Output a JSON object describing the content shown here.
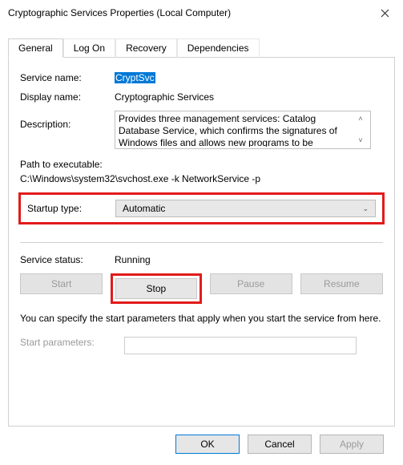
{
  "window": {
    "title": "Cryptographic Services Properties (Local Computer)"
  },
  "tabs": {
    "items": [
      {
        "label": "General"
      },
      {
        "label": "Log On"
      },
      {
        "label": "Recovery"
      },
      {
        "label": "Dependencies"
      }
    ]
  },
  "general": {
    "service_name_label": "Service name:",
    "service_name_value": "CryptSvc",
    "display_name_label": "Display name:",
    "display_name_value": "Cryptographic Services",
    "description_label": "Description:",
    "description_value": "Provides three management services: Catalog Database Service, which confirms the signatures of Windows files and allows new programs to be",
    "path_label": "Path to executable:",
    "path_value": "C:\\Windows\\system32\\svchost.exe -k NetworkService -p",
    "startup_type_label": "Startup type:",
    "startup_type_value": "Automatic",
    "service_status_label": "Service status:",
    "service_status_value": "Running",
    "buttons": {
      "start": "Start",
      "stop": "Stop",
      "pause": "Pause",
      "resume": "Resume"
    },
    "note": "You can specify the start parameters that apply when you start the service from here.",
    "start_parameters_label": "Start parameters:",
    "start_parameters_value": ""
  },
  "dialog_buttons": {
    "ok": "OK",
    "cancel": "Cancel",
    "apply": "Apply"
  }
}
